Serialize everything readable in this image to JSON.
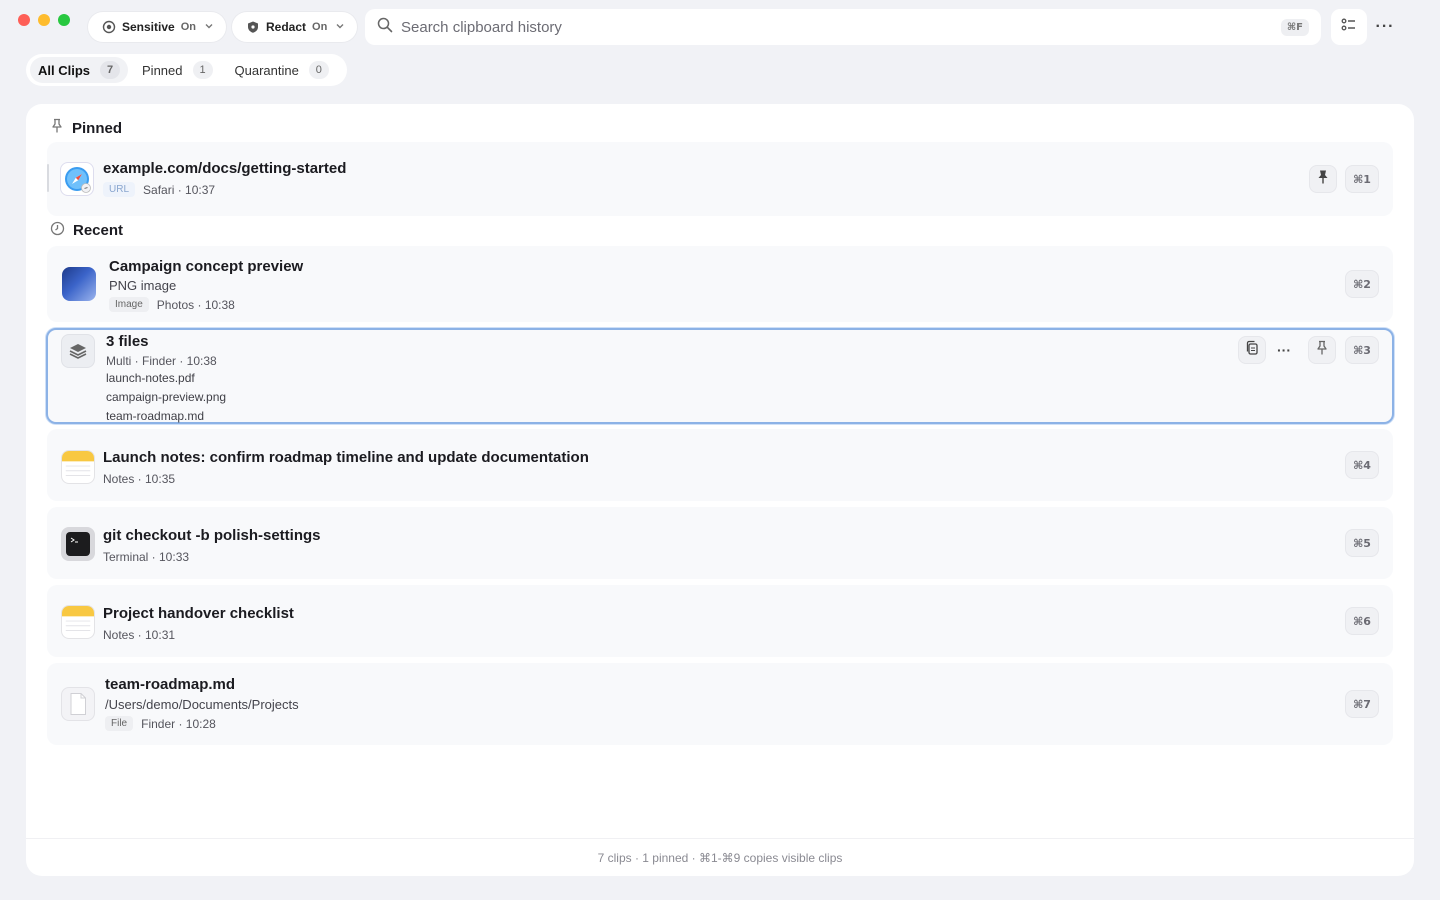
{
  "toolbar": {
    "sensitive": {
      "label": "Sensitive",
      "state": "On"
    },
    "redact": {
      "label": "Redact",
      "state": "On"
    },
    "search_placeholder": "Search clipboard history",
    "search_shortcut": "⌘F",
    "more_label": "···"
  },
  "tabs": [
    {
      "label": "All Clips",
      "count": "7"
    },
    {
      "label": "Pinned",
      "count": "1"
    },
    {
      "label": "Quarantine",
      "count": "0"
    }
  ],
  "sections": {
    "pinned": "Pinned",
    "recent": "Recent"
  },
  "clips": [
    {
      "title": "example.com/docs/getting-started",
      "badge": "URL",
      "meta": "Safari · 10:37",
      "shortcut": "⌘1",
      "icon": "safari-icon"
    },
    {
      "title": "Campaign concept preview",
      "subtitle": "PNG image",
      "badge": "Image",
      "meta": "Photos · 10:38",
      "shortcut": "⌘2",
      "icon": "image-thumbnail"
    },
    {
      "title": "3 files",
      "meta": "Multi · Finder · 10:38",
      "files": [
        "launch-notes.pdf",
        "campaign-preview.png",
        "team-roadmap.md"
      ],
      "shortcut": "⌘3",
      "icon": "stack-icon",
      "more": "···"
    },
    {
      "title": "Launch notes: confirm roadmap timeline and update documentation",
      "meta": "Notes · 10:35",
      "shortcut": "⌘4",
      "icon": "notes-icon"
    },
    {
      "title": "git checkout -b polish-settings",
      "meta": "Terminal · 10:33",
      "shortcut": "⌘5",
      "icon": "terminal-icon"
    },
    {
      "title": "Project handover checklist",
      "meta": "Notes · 10:31",
      "shortcut": "⌘6",
      "icon": "notes-icon"
    },
    {
      "title": "team-roadmap.md",
      "subtitle": "/Users/demo/Documents/Projects",
      "badge": "File",
      "meta": "Finder · 10:28",
      "shortcut": "⌘7",
      "icon": "document-icon"
    }
  ],
  "footer": "7 clips · 1 pinned · ⌘1-⌘9 copies visible clips",
  "colors": {
    "accent": "#8cb2e6",
    "background": "#f1f2f6"
  }
}
